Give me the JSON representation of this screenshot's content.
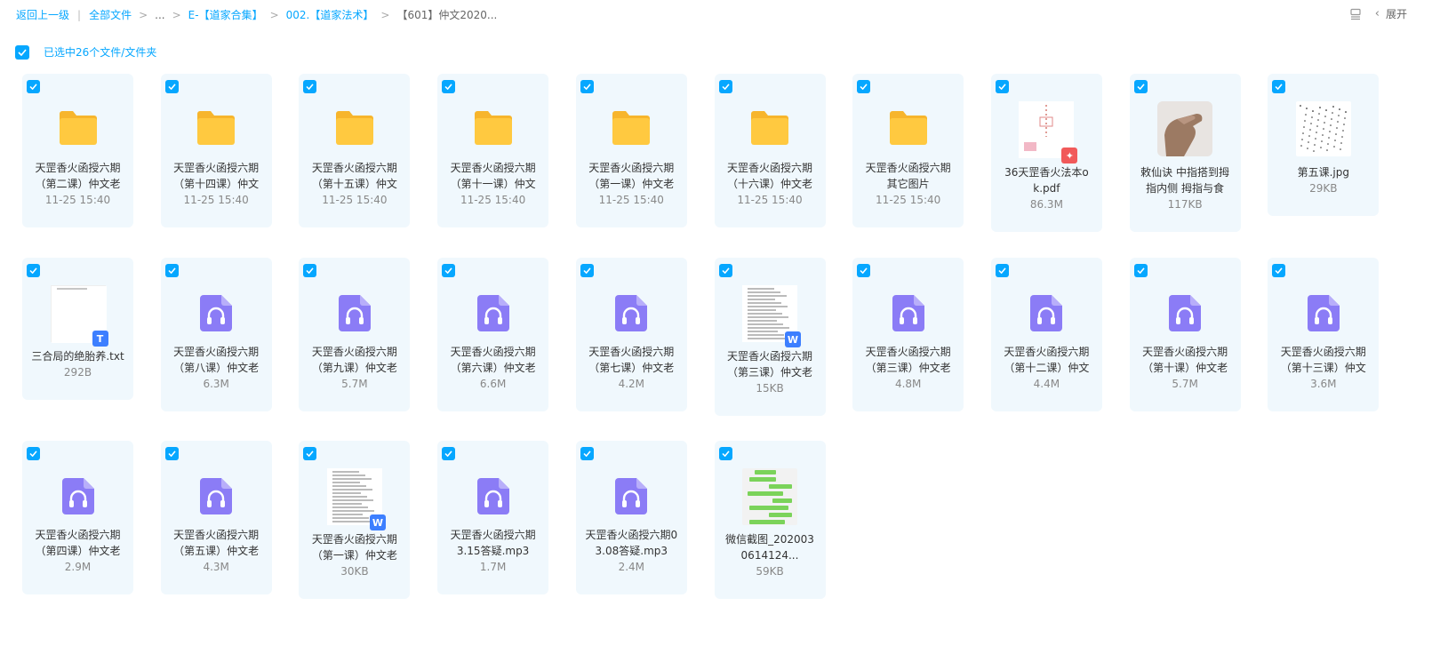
{
  "breadcrumb": {
    "back": "返回上一级",
    "all_files": "全部文件",
    "ellipsis": "...",
    "level1": "E-【道家合集】",
    "level2": "002.【道家法术】",
    "current": "【601】仲文2020..."
  },
  "header": {
    "list_view_icon": "list-view-icon",
    "collapse_label": "展开"
  },
  "selection": {
    "label": "已选中26个文件/文件夹",
    "checked": true
  },
  "colors": {
    "accent": "#06a7ff",
    "card_bg": "#f0f8fd",
    "folder": "#ffc940",
    "audio": "#8b7cf6",
    "pdf_badge": "#f15a5a",
    "word_badge": "#3d7fff"
  },
  "files": [
    {
      "type": "folder",
      "line1": "天罡香火函授六期",
      "line2": "（第二课）仲文老",
      "meta": "11-25 15:40"
    },
    {
      "type": "folder",
      "line1": "天罡香火函授六期",
      "line2": "（第十四课）仲文",
      "meta": "11-25 15:40"
    },
    {
      "type": "folder",
      "line1": "天罡香火函授六期",
      "line2": "（第十五课）仲文",
      "meta": "11-25 15:40"
    },
    {
      "type": "folder",
      "line1": "天罡香火函授六期",
      "line2": "（第十一课）仲文",
      "meta": "11-25 15:40"
    },
    {
      "type": "folder",
      "line1": "天罡香火函授六期",
      "line2": "（第一课）仲文老",
      "meta": "11-25 15:40"
    },
    {
      "type": "folder",
      "line1": "天罡香火函授六期",
      "line2": "（十六课）仲文老",
      "meta": "11-25 15:40"
    },
    {
      "type": "folder",
      "line1": "天罡香火函授六期",
      "line2": "其它图片",
      "meta": "11-25 15:40"
    },
    {
      "type": "pdf",
      "line1": "36天罡香火法本o",
      "line2": "k.pdf",
      "meta": "86.3M"
    },
    {
      "type": "photo",
      "line1": "敕仙诀 中指搭到拇",
      "line2": "指内侧 拇指与食",
      "meta": "117KB"
    },
    {
      "type": "image",
      "line1": "第五课.jpg",
      "line2": "",
      "meta": "29KB"
    },
    {
      "type": "txt",
      "line1": "三合局的绝胎养.txt",
      "line2": "",
      "meta": "292B"
    },
    {
      "type": "audio",
      "line1": "天罡香火函授六期",
      "line2": "（第八课）仲文老",
      "meta": "6.3M"
    },
    {
      "type": "audio",
      "line1": "天罡香火函授六期",
      "line2": "（第九课）仲文老",
      "meta": "5.7M"
    },
    {
      "type": "audio",
      "line1": "天罡香火函授六期",
      "line2": "（第六课）仲文老",
      "meta": "6.6M"
    },
    {
      "type": "audio",
      "line1": "天罡香火函授六期",
      "line2": "（第七课）仲文老",
      "meta": "4.2M"
    },
    {
      "type": "word",
      "line1": "天罡香火函授六期",
      "line2": "（第三课）仲文老",
      "meta": "15KB"
    },
    {
      "type": "audio",
      "line1": "天罡香火函授六期",
      "line2": "（第三课）仲文老",
      "meta": "4.8M"
    },
    {
      "type": "audio",
      "line1": "天罡香火函授六期",
      "line2": "（第十二课）仲文",
      "meta": "4.4M"
    },
    {
      "type": "audio",
      "line1": "天罡香火函授六期",
      "line2": "（第十课）仲文老",
      "meta": "5.7M"
    },
    {
      "type": "audio",
      "line1": "天罡香火函授六期",
      "line2": "（第十三课）仲文",
      "meta": "3.6M"
    },
    {
      "type": "audio",
      "line1": "天罡香火函授六期",
      "line2": "（第四课）仲文老",
      "meta": "2.9M"
    },
    {
      "type": "audio",
      "line1": "天罡香火函授六期",
      "line2": "（第五课）仲文老",
      "meta": "4.3M"
    },
    {
      "type": "word",
      "line1": "天罡香火函授六期",
      "line2": "（第一课）仲文老",
      "meta": "30KB"
    },
    {
      "type": "audio",
      "line1": "天罡香火函授六期",
      "line2": "3.15答疑.mp3",
      "meta": "1.7M"
    },
    {
      "type": "audio",
      "line1": "天罡香火函授六期0",
      "line2": "3.08答疑.mp3",
      "meta": "2.4M"
    },
    {
      "type": "chat",
      "line1": "微信截图_202003",
      "line2": "0614124...",
      "meta": "59KB"
    }
  ]
}
